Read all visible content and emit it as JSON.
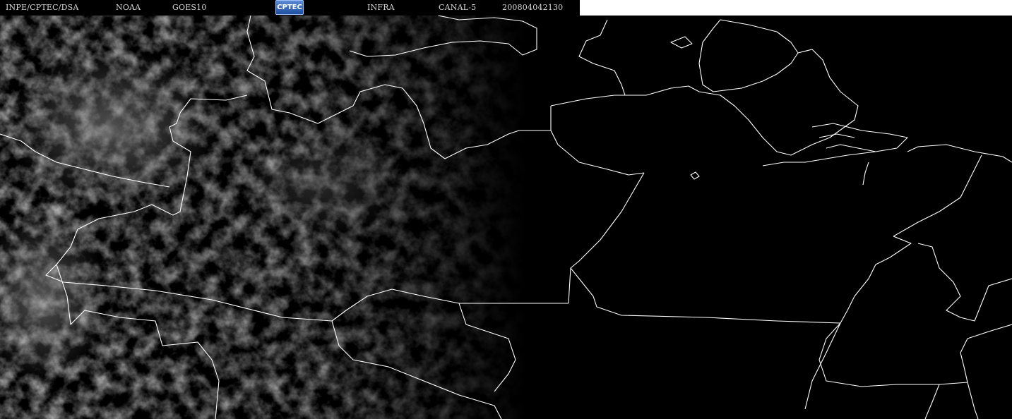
{
  "header": {
    "institution": "INPE/CPTEC/DSA",
    "agency": "NOAA",
    "satellite": "GOES10",
    "logo_text": "CPTEC",
    "band": "INFRA",
    "channel": "CANAL-5",
    "timestamp": "200804042130"
  },
  "colors": {
    "background": "#000000",
    "borders": "#ffffff",
    "header_text": "#d8d8d8",
    "clouds": "#8a8a8a"
  }
}
